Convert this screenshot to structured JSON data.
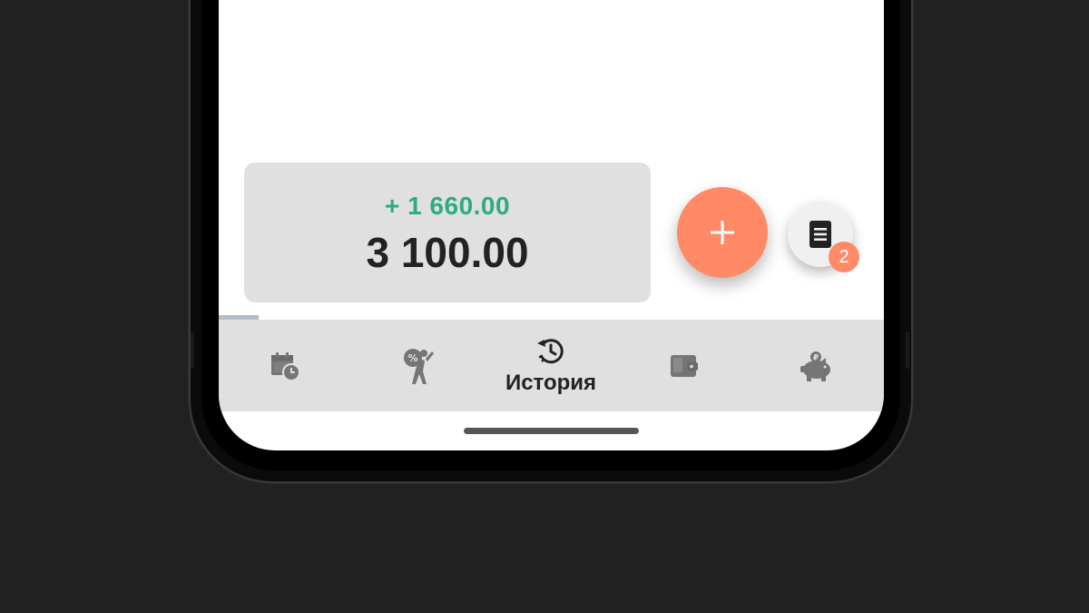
{
  "balance": {
    "change": "+ 1 660.00",
    "total": "3 100.00"
  },
  "actions": {
    "add_icon": "plus-icon",
    "documents_icon": "document-icon",
    "documents_badge": "2"
  },
  "nav": {
    "items": [
      {
        "id": "calendar",
        "icon": "calendar-clock-icon",
        "label": "",
        "active": false
      },
      {
        "id": "debts",
        "icon": "debt-burden-icon",
        "label": "",
        "active": false
      },
      {
        "id": "history",
        "icon": "history-icon",
        "label": "История",
        "active": true
      },
      {
        "id": "wallet",
        "icon": "wallet-icon",
        "label": "",
        "active": false
      },
      {
        "id": "savings",
        "icon": "piggy-bank-icon",
        "label": "",
        "active": false
      }
    ]
  },
  "colors": {
    "accent": "#ff8a65",
    "income": "#2eac7e",
    "card": "#e0e0e0",
    "nav_icon": "#757575",
    "text_dark": "#222222"
  }
}
